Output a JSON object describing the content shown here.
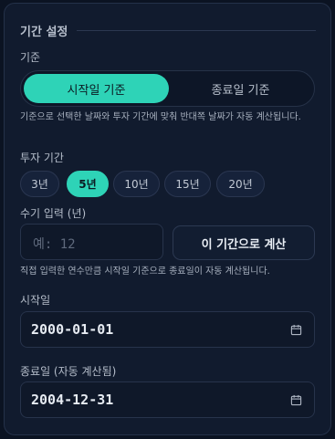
{
  "section": {
    "title": "기간 설정"
  },
  "basis": {
    "label": "기준",
    "options": [
      "시작일 기준",
      "종료일 기준"
    ],
    "selected": "시작일 기준",
    "help": "기준으로 선택한 날짜와 투자 기간에 맞춰 반대쪽 날짜가 자동 계산됩니다."
  },
  "period": {
    "label": "투자 기간",
    "chips": [
      "3년",
      "5년",
      "10년",
      "15년",
      "20년"
    ],
    "selected": "5년"
  },
  "manual": {
    "label": "수기 입력 (년)",
    "placeholder": "예: 12",
    "button": "이 기간으로 계산",
    "help": "직접 입력한 연수만큼 시작일 기준으로 종료일이 자동 계산됩니다."
  },
  "start": {
    "label": "시작일",
    "value": "2000-01-01",
    "icon": "calendar-icon"
  },
  "end": {
    "label": "종료일 (자동 계산됨)",
    "value": "2004-12-31",
    "icon": "calendar-icon"
  },
  "colors": {
    "accent": "#2ed3b7",
    "background": "#0b1322",
    "panel": "#111b2e"
  }
}
